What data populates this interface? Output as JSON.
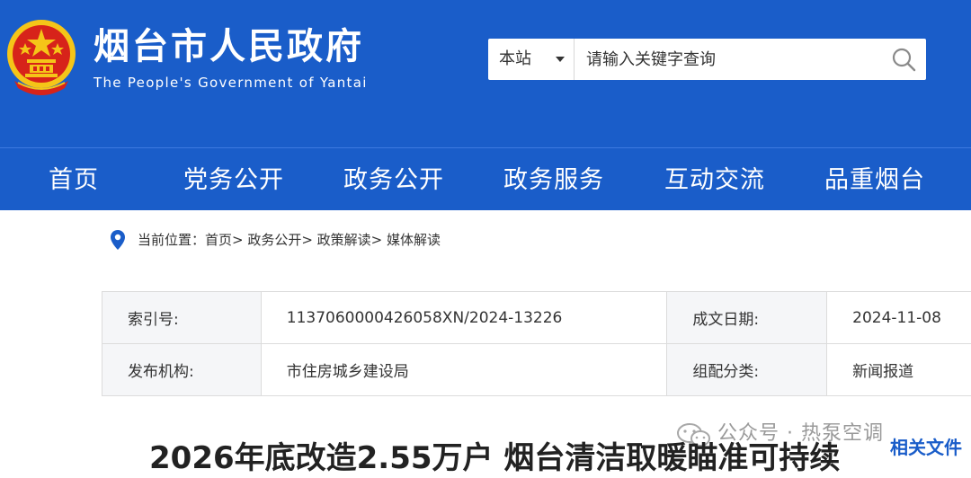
{
  "header": {
    "title": "烟台市人民政府",
    "subtitle": "The People's Government of Yantai",
    "emblem_icon": "national-emblem-icon",
    "colors": {
      "brand_blue": "#1a5dc9",
      "emblem_red": "#d7231a",
      "emblem_gold": "#f5c518"
    }
  },
  "search": {
    "scope_label": "本站",
    "placeholder": "请输入关键字查询",
    "button_icon": "search-icon"
  },
  "nav": {
    "items": [
      {
        "label": "首页"
      },
      {
        "label": "党务公开"
      },
      {
        "label": "政务公开"
      },
      {
        "label": "政务服务"
      },
      {
        "label": "互动交流"
      },
      {
        "label": "品重烟台"
      }
    ]
  },
  "breadcrumb": {
    "icon": "location-pin-icon",
    "text": "当前位置：首页> 政务公开> 政策解读> 媒体解读"
  },
  "meta": {
    "index_label": "索引号:",
    "index_value": "113706000042605​8XN/2024-13226",
    "date_label": "成文日期:",
    "date_value": "2024-11-08",
    "org_label": "发布机构:",
    "org_value": "市住房城乡建设局",
    "category_label": "组配分类:",
    "category_value": "新闻报道"
  },
  "watermark": {
    "icon": "wechat-icon",
    "text": "公众号 · 热泵空调"
  },
  "article": {
    "title": "2026年底改造2.55万户 烟台清洁取暖瞄准可持续"
  },
  "related": {
    "label": "相关文件"
  }
}
